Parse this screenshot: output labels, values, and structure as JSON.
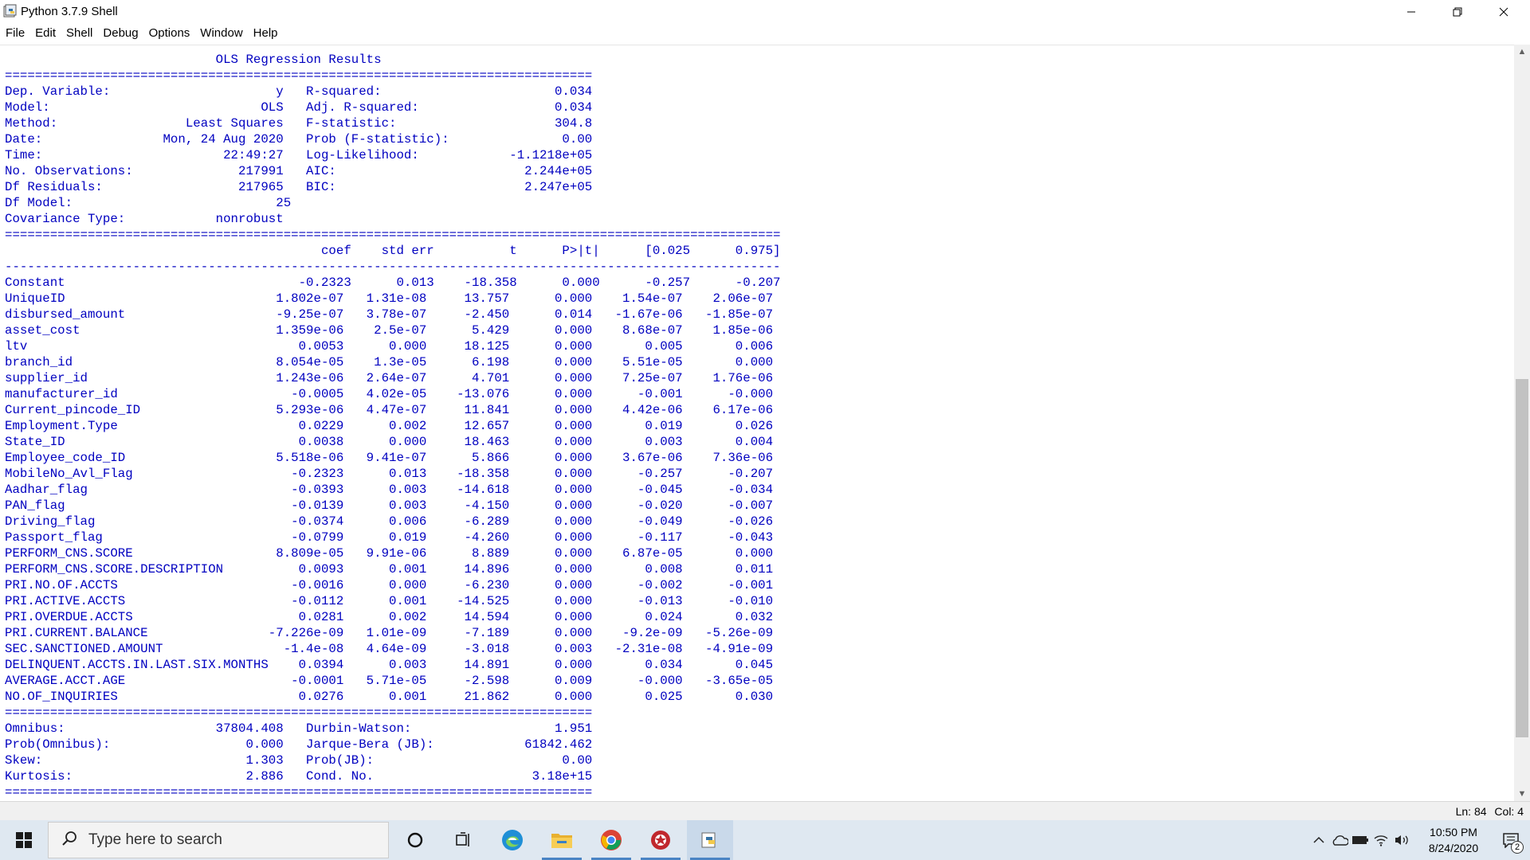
{
  "window": {
    "title": "Python 3.7.9 Shell",
    "controls": {
      "minimize": "—",
      "maximize": "❐",
      "close": "✕"
    }
  },
  "menu": [
    "File",
    "Edit",
    "Shell",
    "Debug",
    "Options",
    "Window",
    "Help"
  ],
  "shell_lines": [
    "                            OLS Regression Results                            ",
    "==============================================================================",
    "Dep. Variable:                      y   R-squared:                       0.034",
    "Model:                            OLS   Adj. R-squared:                  0.034",
    "Method:                 Least Squares   F-statistic:                     304.8",
    "Date:                Mon, 24 Aug 2020   Prob (F-statistic):               0.00",
    "Time:                        22:49:27   Log-Likelihood:            -1.1218e+05",
    "No. Observations:              217991   AIC:                         2.244e+05",
    "Df Residuals:                  217965   BIC:                         2.247e+05",
    "Df Model:                           25                                         ",
    "Covariance Type:            nonrobust                                         ",
    "=======================================================================================================",
    "                                          coef    std err          t      P>|t|      [0.025      0.975]",
    "-------------------------------------------------------------------------------------------------------",
    "Constant                               -0.2323      0.013    -18.358      0.000      -0.257      -0.207",
    "UniqueID                            1.802e-07   1.31e-08     13.757      0.000    1.54e-07    2.06e-07",
    "disbursed_amount                    -9.25e-07   3.78e-07     -2.450      0.014   -1.67e-06   -1.85e-07",
    "asset_cost                          1.359e-06    2.5e-07      5.429      0.000    8.68e-07    1.85e-06",
    "ltv                                    0.0053      0.000     18.125      0.000       0.005       0.006",
    "branch_id                           8.054e-05    1.3e-05      6.198      0.000    5.51e-05       0.000",
    "supplier_id                         1.243e-06   2.64e-07      4.701      0.000    7.25e-07    1.76e-06",
    "manufacturer_id                       -0.0005   4.02e-05    -13.076      0.000      -0.001      -0.000",
    "Current_pincode_ID                  5.293e-06   4.47e-07     11.841      0.000    4.42e-06    6.17e-06",
    "Employment.Type                        0.0229      0.002     12.657      0.000       0.019       0.026",
    "State_ID                               0.0038      0.000     18.463      0.000       0.003       0.004",
    "Employee_code_ID                    5.518e-06   9.41e-07      5.866      0.000    3.67e-06    7.36e-06",
    "MobileNo_Avl_Flag                     -0.2323      0.013    -18.358      0.000      -0.257      -0.207",
    "Aadhar_flag                           -0.0393      0.003    -14.618      0.000      -0.045      -0.034",
    "PAN_flag                              -0.0139      0.003     -4.150      0.000      -0.020      -0.007",
    "Driving_flag                          -0.0374      0.006     -6.289      0.000      -0.049      -0.026",
    "Passport_flag                         -0.0799      0.019     -4.260      0.000      -0.117      -0.043",
    "PERFORM_CNS.SCORE                   8.809e-05   9.91e-06      8.889      0.000    6.87e-05       0.000",
    "PERFORM_CNS.SCORE.DESCRIPTION          0.0093      0.001     14.896      0.000       0.008       0.011",
    "PRI.NO.OF.ACCTS                       -0.0016      0.000     -6.230      0.000      -0.002      -0.001",
    "PRI.ACTIVE.ACCTS                      -0.0112      0.001    -14.525      0.000      -0.013      -0.010",
    "PRI.OVERDUE.ACCTS                      0.0281      0.002     14.594      0.000       0.024       0.032",
    "PRI.CURRENT.BALANCE                -7.226e-09   1.01e-09     -7.189      0.000    -9.2e-09   -5.26e-09",
    "SEC.SANCTIONED.AMOUNT                -1.4e-08   4.64e-09     -3.018      0.003   -2.31e-08   -4.91e-09",
    "DELINQUENT.ACCTS.IN.LAST.SIX.MONTHS    0.0394      0.003     14.891      0.000       0.034       0.045",
    "AVERAGE.ACCT.AGE                      -0.0001   5.71e-05     -2.598      0.009      -0.000   -3.65e-05",
    "NO.OF_INQUIRIES                        0.0276      0.001     21.862      0.000       0.025       0.030",
    "==============================================================================",
    "Omnibus:                    37804.408   Durbin-Watson:                   1.951",
    "Prob(Omnibus):                  0.000   Jarque-Bera (JB):            61842.462",
    "Skew:                           1.303   Prob(JB):                         0.00",
    "Kurtosis:                       2.886   Cond. No.                     3.18e+15",
    "=============================================================================="
  ],
  "status": {
    "line": "Ln: 84",
    "col": "Col: 4"
  },
  "taskbar": {
    "search_placeholder": "Type here to search",
    "time": "10:50 PM",
    "date": "8/24/2020",
    "notification_count": "2"
  }
}
